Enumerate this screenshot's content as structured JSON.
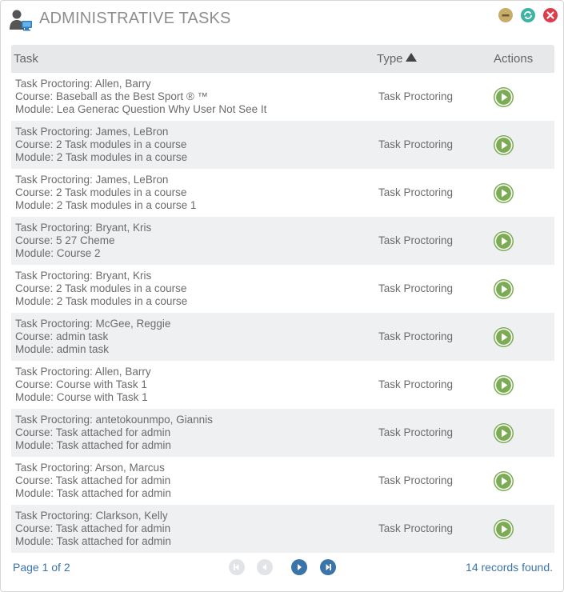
{
  "header": {
    "title": "ADMINISTRATIVE TASKS"
  },
  "table": {
    "columns": {
      "task": "Task",
      "type": "Type",
      "actions": "Actions"
    },
    "rows": [
      {
        "line1": "Task Proctoring: Allen, Barry",
        "line2": "Course: Baseball as the Best Sport ® ™",
        "line3": "Module: Lea Generac Question Why User Not See It",
        "type": "Task Proctoring"
      },
      {
        "line1": "Task Proctoring: James, LeBron",
        "line2": "Course: 2 Task modules in a course",
        "line3": "Module: 2 Task modules in a course",
        "type": "Task Proctoring"
      },
      {
        "line1": "Task Proctoring: James, LeBron",
        "line2": "Course: 2 Task modules in a course",
        "line3": "Module: 2 Task modules in a course 1",
        "type": "Task Proctoring"
      },
      {
        "line1": "Task Proctoring: Bryant, Kris",
        "line2": "Course: 5 27 Cheme",
        "line3": "Module: Course 2",
        "type": "Task Proctoring"
      },
      {
        "line1": "Task Proctoring: Bryant, Kris",
        "line2": "Course: 2 Task modules in a course",
        "line3": "Module: 2 Task modules in a course",
        "type": "Task Proctoring"
      },
      {
        "line1": "Task Proctoring: McGee, Reggie",
        "line2": "Course: admin task",
        "line3": "Module: admin task",
        "type": "Task Proctoring"
      },
      {
        "line1": "Task Proctoring: Allen, Barry",
        "line2": "Course: Course with Task 1",
        "line3": "Module: Course with Task 1",
        "type": "Task Proctoring"
      },
      {
        "line1": "Task Proctoring: antetokounmpo, Giannis",
        "line2": "Course: Task attached for admin",
        "line3": "Module: Task attached for admin",
        "type": "Task Proctoring"
      },
      {
        "line1": "Task Proctoring: Arson, Marcus",
        "line2": "Course: Task attached for admin",
        "line3": "Module: Task attached for admin",
        "type": "Task Proctoring"
      },
      {
        "line1": "Task Proctoring: Clarkson, Kelly",
        "line2": "Course: Task attached for admin",
        "line3": "Module: Task attached for admin",
        "type": "Task Proctoring"
      }
    ]
  },
  "footer": {
    "page_info": "Page 1 of 2",
    "records": "14 records found."
  },
  "colors": {
    "accent": "#3b74a8",
    "play": "#7bab52",
    "minimize": "#c8ad6a",
    "refresh": "#3fb3a3",
    "close": "#dd3c4b",
    "header_bg": "#e6e8ea",
    "alt_row": "#eff0f2"
  },
  "icons": {
    "header": "admin-user-computer-icon",
    "minimize": "minimize-icon",
    "refresh": "refresh-icon",
    "close": "close-icon",
    "sort": "sort-asc-triangle-icon",
    "action": "play-icon",
    "first": "first-page-icon",
    "prev": "prev-page-icon",
    "next": "next-page-icon",
    "last": "last-page-icon"
  }
}
